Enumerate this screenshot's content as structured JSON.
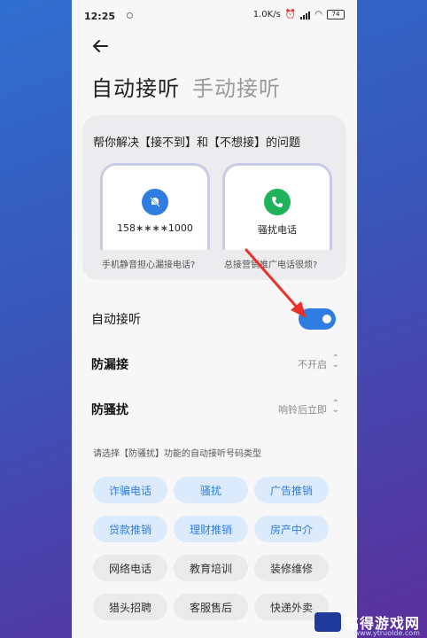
{
  "status": {
    "time": "12:25",
    "speed": "1.0K/s",
    "battery": "74"
  },
  "tabs": {
    "active": "自动接听",
    "inactive": "手动接听"
  },
  "card": {
    "title": "帮你解决【接不到】和【不想接】的问题",
    "left": {
      "label": "158∗∗∗∗1000",
      "caption": "手机静音担心漏接电话?"
    },
    "right": {
      "label": "骚扰电话",
      "caption": "总接营销推广电话很烦?"
    }
  },
  "rows": {
    "auto_answer": {
      "label": "自动接听",
      "on": true
    },
    "anti_miss": {
      "label": "防漏接",
      "value": "不开启"
    },
    "anti_harass": {
      "label": "防骚扰",
      "value": "响铃后立即"
    }
  },
  "hint": "请选择【防骚扰】功能的自动接听号码类型",
  "chips": [
    {
      "label": "诈骗电话",
      "selected": true
    },
    {
      "label": "骚扰",
      "selected": true
    },
    {
      "label": "广告推销",
      "selected": true
    },
    {
      "label": "贷款推销",
      "selected": true
    },
    {
      "label": "理财推销",
      "selected": true
    },
    {
      "label": "房产中介",
      "selected": true
    },
    {
      "label": "网络电话",
      "selected": false
    },
    {
      "label": "教育培训",
      "selected": false
    },
    {
      "label": "装修维修",
      "selected": false
    },
    {
      "label": "猎头招聘",
      "selected": false
    },
    {
      "label": "客服售后",
      "selected": false
    },
    {
      "label": "快递外卖",
      "selected": false
    }
  ],
  "watermark": {
    "name": "铭得游戏网",
    "url": "www.ytruolde.com"
  },
  "colors": {
    "accent": "#2f7de1",
    "chip_selected_bg": "#dcebfb",
    "arrow": "#e8322b"
  }
}
